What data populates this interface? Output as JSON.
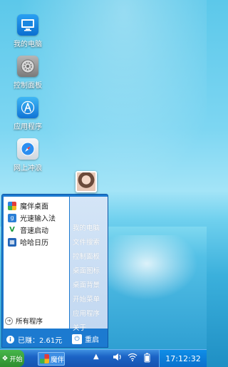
{
  "desktop": {
    "icons": [
      {
        "label": "我的电脑",
        "icon": "computer-icon"
      },
      {
        "label": "控制面板",
        "icon": "settings-gear-icon"
      },
      {
        "label": "应用程序",
        "icon": "app-store-icon"
      },
      {
        "label": "网上冲浪",
        "icon": "safari-compass-icon"
      }
    ]
  },
  "start_menu": {
    "left_items": [
      {
        "label": "魔伴桌面",
        "icon": "pinwheel-icon"
      },
      {
        "label": "光速输入法",
        "icon": "input-method-icon"
      },
      {
        "label": "音速启动",
        "icon": "v-launch-icon"
      },
      {
        "label": "哈哈日历",
        "icon": "calendar-icon"
      }
    ],
    "all_programs": "所有程序",
    "right_links": [
      "我的电脑",
      "文件搜索",
      "控制面板",
      "桌面图标",
      "桌面背景",
      "开始菜单",
      "应用程序",
      "关于"
    ],
    "earned": "已赚：2.61元",
    "restart": "重启"
  },
  "taskbar": {
    "start_label": "开始",
    "app_label": "魔伴",
    "clock": "17:12:32"
  },
  "colors": {
    "taskbar": "#1b63c5",
    "menu_frame": "#1c7ad0",
    "start_green": "#3a9f3c"
  }
}
